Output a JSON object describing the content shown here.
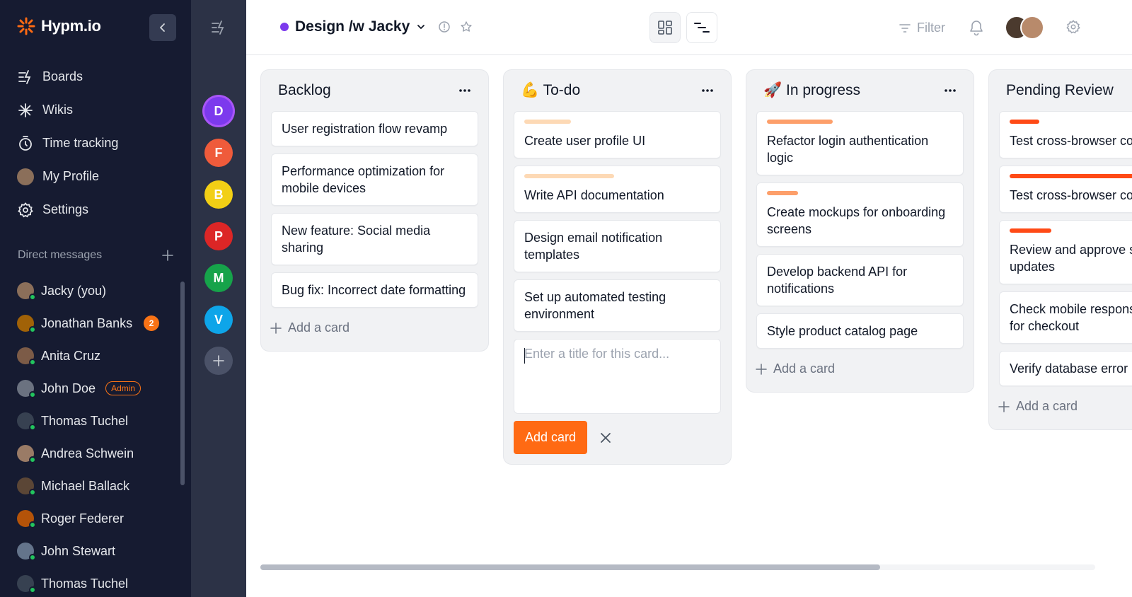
{
  "app": {
    "name": "Hypm.io"
  },
  "sidebar": {
    "nav": [
      {
        "label": "Boards",
        "icon": "boards-icon"
      },
      {
        "label": "Wikis",
        "icon": "asterisk-icon"
      },
      {
        "label": "Time tracking",
        "icon": "stopwatch-icon"
      },
      {
        "label": "My Profile",
        "icon": "avatar"
      },
      {
        "label": "Settings",
        "icon": "gear-icon"
      }
    ],
    "dm_title": "Direct messages",
    "dms": [
      {
        "name": "Jacky (you)",
        "color": "#8b6f5a"
      },
      {
        "name": "Jonathan Banks",
        "color": "#a16207",
        "count": "2"
      },
      {
        "name": "Anita Cruz",
        "color": "#7c5b47"
      },
      {
        "name": "John Doe",
        "color": "#6b7280",
        "badge": "Admin"
      },
      {
        "name": "Thomas Tuchel",
        "color": "#374151"
      },
      {
        "name": "Andrea Schwein",
        "color": "#9a7b66"
      },
      {
        "name": "Michael Ballack",
        "color": "#5b4636"
      },
      {
        "name": "Roger Federer",
        "color": "#b45309"
      },
      {
        "name": "John Stewart",
        "color": "#64748b"
      },
      {
        "name": "Thomas Tuchel",
        "color": "#374151"
      }
    ]
  },
  "workspaces": [
    {
      "letter": "D",
      "color": "#7c3aed"
    },
    {
      "letter": "F",
      "color": "#ef5b3b"
    },
    {
      "letter": "B",
      "color": "#f2cf15"
    },
    {
      "letter": "P",
      "color": "#dc2626"
    },
    {
      "letter": "M",
      "color": "#16a34a"
    },
    {
      "letter": "V",
      "color": "#0ea5e9"
    }
  ],
  "header": {
    "title": "Design /w Jacky",
    "filter_label": "Filter"
  },
  "board": {
    "columns": [
      {
        "title": "Backlog",
        "cards": [
          {
            "text": "User registration flow revamp"
          },
          {
            "text": "Performance optimization for mobile devices"
          },
          {
            "text": "New feature: Social media sharing"
          },
          {
            "text": "Bug fix: Incorrect date formatting"
          }
        ],
        "add_label": "Add a card"
      },
      {
        "title": "💪 To-do",
        "cards": [
          {
            "text": "Create user profile UI",
            "bar": "#fdd9b5",
            "bar_fraction": 0.24
          },
          {
            "text": "Write API documentation",
            "bar": "#fdd9b5",
            "bar_fraction": 0.44
          },
          {
            "text": "Design email notification templates"
          },
          {
            "text": "Set up automated testing environment"
          }
        ],
        "composer_placeholder": "Enter a title for this card...",
        "add_button": "Add card"
      },
      {
        "title": "🚀 In progress",
        "cards": [
          {
            "text": "Refactor login authentication logic",
            "bar": "#fd9f6a",
            "bar_fraction": 0.34
          },
          {
            "text": "Create mockups for onboarding screens",
            "bar": "#fd9f6a",
            "bar_fraction": 0.16
          },
          {
            "text": "Develop backend API for notifications"
          },
          {
            "text": "Style product catalog page"
          }
        ],
        "add_label": "Add a card"
      },
      {
        "title": "Pending Review",
        "cards": [
          {
            "text": "Test cross-browser compatibility",
            "bar": "#ff4a16",
            "bar_fraction": 0.15
          },
          {
            "text": "Test cross-browser compatibility",
            "bar": "#ff4a16",
            "bar_fraction": 1.0
          },
          {
            "text": "Review and approve service updates",
            "bar": "#ff4a16",
            "bar_fraction": 0.21
          },
          {
            "text": "Check mobile responsiveness for checkout"
          },
          {
            "text": "Verify database error handling"
          }
        ],
        "add_label": "Add a card"
      }
    ]
  },
  "colors": {
    "accent": "#ff6a13",
    "sidebar_bg": "#161b31",
    "rail_bg": "#2c3246"
  }
}
